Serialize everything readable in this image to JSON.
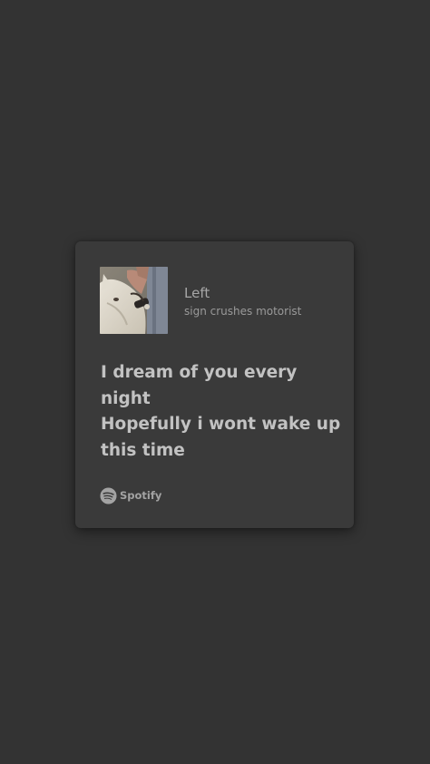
{
  "track": {
    "title": "Left",
    "artist": "sign crushes motorist"
  },
  "lyrics": [
    "I dream of you every",
    "night",
    "Hopefully i wont wake up",
    "this time"
  ],
  "brand": {
    "name": "Spotify",
    "icon": "spotify-logo-icon"
  },
  "colors": {
    "background": "#333333",
    "card": "#3a3a3a",
    "lyrics_text": "#c2c2c2",
    "meta_text": "#a7a7a7"
  }
}
